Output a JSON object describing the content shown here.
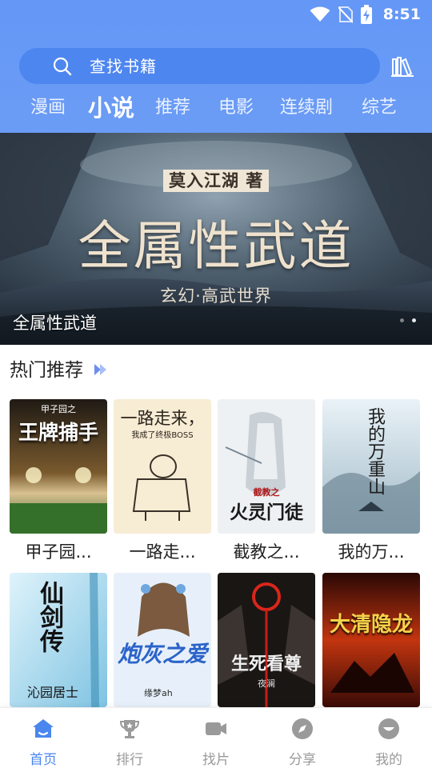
{
  "status_bar": {
    "time": "8:51"
  },
  "search": {
    "placeholder": "查找书籍"
  },
  "tabs": [
    {
      "label": "漫画",
      "active": false
    },
    {
      "label": "小说",
      "active": true
    },
    {
      "label": "推荐",
      "active": false
    },
    {
      "label": "电影",
      "active": false
    },
    {
      "label": "连续剧",
      "active": false
    },
    {
      "label": "综艺",
      "active": false
    }
  ],
  "banner": {
    "author": "莫入江湖 著",
    "title_art": "全属性武道",
    "subtitle": "玄幻·高武世界",
    "caption": "全属性武道",
    "slide_count": 2,
    "active_slide": 2
  },
  "section": {
    "title": "热门推荐"
  },
  "books": [
    {
      "name": "甲子园...",
      "cover_text": "王牌捕手",
      "cover_top": "甲子园之"
    },
    {
      "name": "一路走...",
      "cover_text": "一路走来，",
      "cover_top": "我成了终极BOSS"
    },
    {
      "name": "截教之...",
      "cover_text": "火灵门徒",
      "cover_top": "截教之"
    },
    {
      "name": "我的万...",
      "cover_text": "我的万重山",
      "cover_top": ""
    },
    {
      "name": "",
      "cover_text": "仙剑传",
      "cover_top": "沁园居士"
    },
    {
      "name": "",
      "cover_text": "炮灰之爱",
      "cover_top": "缘梦ah"
    },
    {
      "name": "",
      "cover_text": "生死看尊",
      "cover_top": "夜澜"
    },
    {
      "name": "",
      "cover_text": "大清隐龙",
      "cover_top": ""
    }
  ],
  "bottom_nav": [
    {
      "label": "首页",
      "icon": "home-icon",
      "active": true
    },
    {
      "label": "排行",
      "icon": "trophy-icon",
      "active": false
    },
    {
      "label": "找片",
      "icon": "video-camera-icon",
      "active": false
    },
    {
      "label": "分享",
      "icon": "compass-icon",
      "active": false
    },
    {
      "label": "我的",
      "icon": "profile-icon",
      "active": false
    }
  ],
  "colors": {
    "header_blue": "#6497f6",
    "search_bg": "#4e86ef",
    "nav_active": "#4a86ee",
    "nav_inactive": "#9a9a9a"
  }
}
